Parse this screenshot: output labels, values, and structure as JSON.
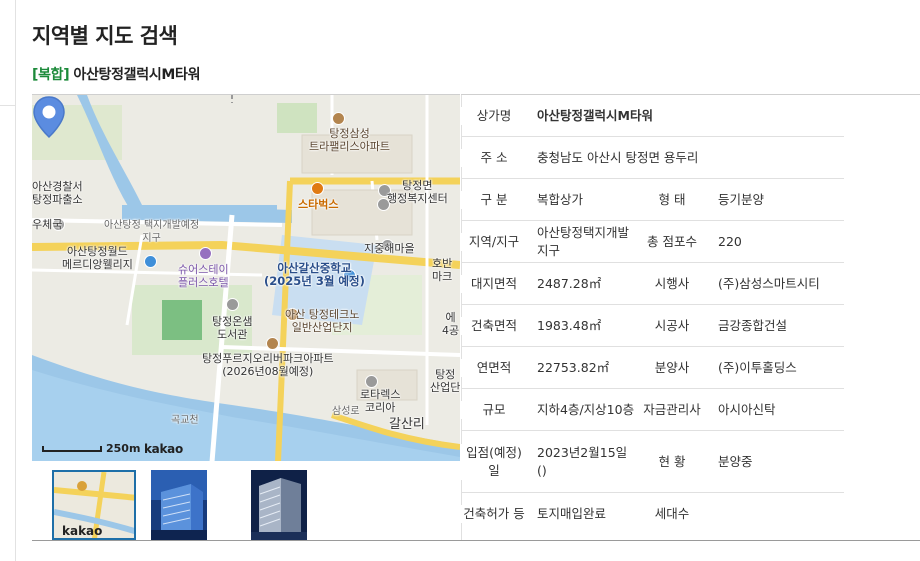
{
  "page": {
    "title": "지역별 지도 검색",
    "category": "[복합]",
    "name": "아산탕정갤럭시M타워"
  },
  "map": {
    "scale_label": "250m",
    "logo": "kakao",
    "labels": {
      "police": "아산경찰서\n탕정파출소",
      "post": "우체국",
      "dist": "아산탕정 택지개발예정\n지구",
      "world": "아산탕정월드\n메르디앙웰리지",
      "stay": "슈어스테이\n플러스호텔",
      "lib": "탕정온샘\n도서관",
      "prugio": "탕정푸르지오리버파크아파트\n(2026년08월예정)",
      "samsung_apt": "탕정삼성\n트라팰리스아파트",
      "starbucks": "스타벅스",
      "center": "탕정면\n행정복지센터",
      "jijung": "지중해마을",
      "school": "아산갈산중학교\n(2025년 3월 예정)",
      "techno": "아산 탕정테크노\n일반산업단지",
      "lotte": "로타렉스\n코리아",
      "galsan": "갈산리",
      "gokgyo": "곡교천",
      "hobeon": "호반\n마크",
      "e4": "에\n4공",
      "tangjeong_ind": "탕정\n산업단",
      "samseong_road": "삼성로"
    }
  },
  "thumbs": {
    "kakao": "kakao"
  },
  "table": {
    "rows": [
      {
        "h1": "상가명",
        "v1": "아산탕정갤럭시M타워"
      },
      {
        "h1": "주 소",
        "v1": "충청남도 아산시 탕정면 용두리"
      },
      {
        "h1": "구 분",
        "v1": "복합상가",
        "h2": "형 태",
        "v2": "등기분양"
      },
      {
        "h1": "지역/지구",
        "v1": "아산탕정택지개발지구",
        "h2": "총 점포수",
        "v2": "220"
      },
      {
        "h1": "대지면적",
        "v1": "2487.28㎡",
        "h2": "시행사",
        "v2": "(주)삼성스마트시티"
      },
      {
        "h1": "건축면적",
        "v1": "1983.48㎡",
        "h2": "시공사",
        "v2": "금강종합건설"
      },
      {
        "h1": "연면적",
        "v1": "22753.82㎡",
        "h2": "분양사",
        "v2": "(주)이투홀딩스"
      },
      {
        "h1": "규모",
        "v1": "지하4층/지상10층",
        "h2": "자금관리사",
        "v2": "아시아신탁"
      },
      {
        "h1": "입점(예정)일",
        "v1": "2023년2월15일()",
        "h2": "현 황",
        "v2": "분양중"
      },
      {
        "h1": "건축허가 등",
        "v1": "토지매입완료",
        "h2": "세대수",
        "v2": ""
      }
    ]
  }
}
